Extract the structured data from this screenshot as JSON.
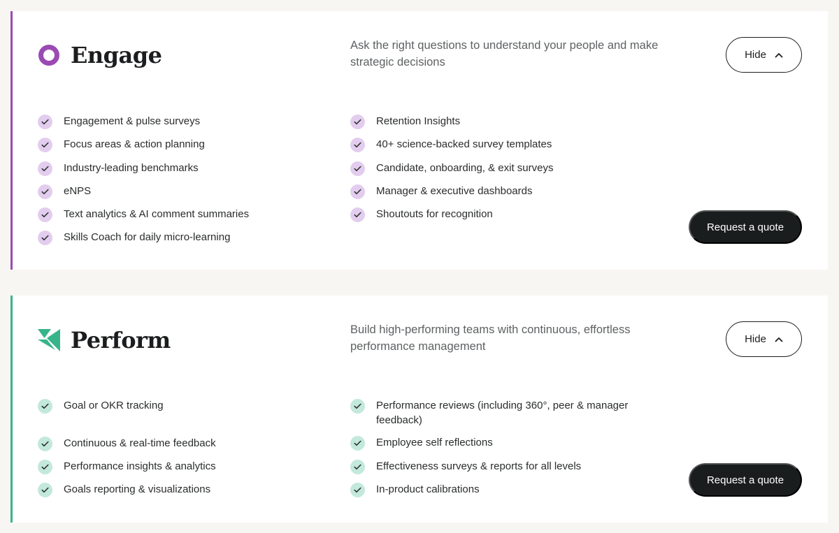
{
  "engage": {
    "title": "Engage",
    "tagline": "Ask the right questions to understand your people and make strategic decisions",
    "hide_label": "Hide",
    "quote_label": "Request a quote",
    "accent": "#9b4ab4",
    "features_left": [
      "Engagement & pulse surveys",
      "Focus areas & action planning",
      "Industry-leading benchmarks",
      "eNPS",
      "Text analytics & AI comment summaries",
      "Skills Coach for daily micro-learning"
    ],
    "features_right": [
      "Retention Insights",
      "40+ science-backed survey templates",
      "Candidate, onboarding, & exit surveys",
      "Manager & executive dashboards",
      "Shoutouts for recognition"
    ]
  },
  "perform": {
    "title": "Perform",
    "tagline": "Build high-performing teams with continuous, effortless performance management",
    "hide_label": "Hide",
    "quote_label": "Request a quote",
    "accent": "#38b48b",
    "features_left": [
      "Goal or OKR tracking",
      "Continuous & real-time feedback",
      "Performance insights & analytics",
      "Goals reporting & visualizations"
    ],
    "features_right": [
      "Performance reviews (including 360°, peer & manager feedback)",
      "Employee self reflections",
      "Effectiveness surveys & reports for all levels",
      "In-product calibrations"
    ]
  }
}
